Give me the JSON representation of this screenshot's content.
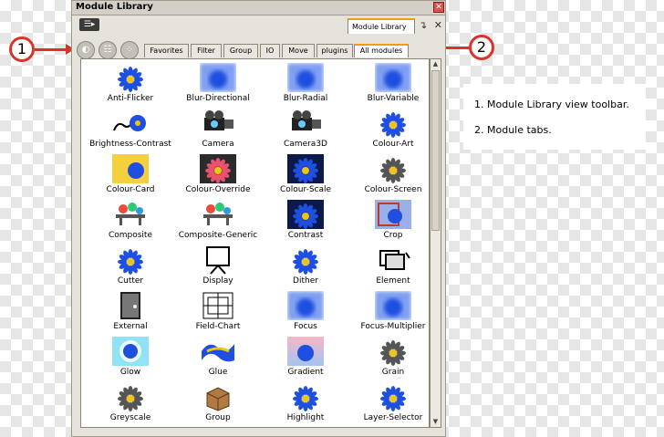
{
  "window": {
    "title": "Module Library",
    "close_glyph": "✕",
    "view_tab_label": "Module Library",
    "view_controls": "↴ ✕",
    "menu_glyph": "☰▸"
  },
  "toolbar": {
    "buttons": [
      {
        "icon": "single-view-icon",
        "glyph": "◐"
      },
      {
        "icon": "list-view-icon",
        "glyph": "☷"
      },
      {
        "icon": "thumbnail-view-icon",
        "glyph": "⁘"
      }
    ]
  },
  "tabs": [
    {
      "label": "Favorites",
      "active": false
    },
    {
      "label": "Filter",
      "active": false
    },
    {
      "label": "Group",
      "active": false
    },
    {
      "label": "IO",
      "active": false
    },
    {
      "label": "Move",
      "active": false
    },
    {
      "label": "plugins",
      "active": false
    },
    {
      "label": "All modules",
      "active": true
    }
  ],
  "modules": [
    {
      "label": "Anti-Flicker",
      "icon": "flower-icon"
    },
    {
      "label": "Blur-Directional",
      "icon": "blur-icon"
    },
    {
      "label": "Blur-Radial",
      "icon": "blur-icon"
    },
    {
      "label": "Blur-Variable",
      "icon": "blur-icon"
    },
    {
      "label": "Brightness-Contrast",
      "icon": "brightness-icon"
    },
    {
      "label": "Camera",
      "icon": "camera-icon"
    },
    {
      "label": "Camera3D",
      "icon": "camera-icon"
    },
    {
      "label": "Colour-Art",
      "icon": "flower-icon"
    },
    {
      "label": "Colour-Card",
      "icon": "colour-card-icon"
    },
    {
      "label": "Colour-Override",
      "icon": "flower-pink-icon"
    },
    {
      "label": "Colour-Scale",
      "icon": "flower-dark-icon"
    },
    {
      "label": "Colour-Screen",
      "icon": "flower-grey-icon"
    },
    {
      "label": "Composite",
      "icon": "composite-icon"
    },
    {
      "label": "Composite-Generic",
      "icon": "composite-icon"
    },
    {
      "label": "Contrast",
      "icon": "flower-dark-icon"
    },
    {
      "label": "Crop",
      "icon": "crop-icon"
    },
    {
      "label": "Cutter",
      "icon": "flower-icon"
    },
    {
      "label": "Display",
      "icon": "display-icon"
    },
    {
      "label": "Dither",
      "icon": "flower-icon"
    },
    {
      "label": "Element",
      "icon": "element-icon"
    },
    {
      "label": "External",
      "icon": "external-icon"
    },
    {
      "label": "Field-Chart",
      "icon": "field-chart-icon"
    },
    {
      "label": "Focus",
      "icon": "blur-icon"
    },
    {
      "label": "Focus-Multiplier",
      "icon": "blur-icon"
    },
    {
      "label": "Glow",
      "icon": "glow-icon"
    },
    {
      "label": "Glue",
      "icon": "glue-icon"
    },
    {
      "label": "Gradient",
      "icon": "gradient-icon"
    },
    {
      "label": "Grain",
      "icon": "flower-grey-icon"
    },
    {
      "label": "Greyscale",
      "icon": "flower-grey-icon"
    },
    {
      "label": "Group",
      "icon": "group-box-icon"
    },
    {
      "label": "Highlight",
      "icon": "flower-icon"
    },
    {
      "label": "Layer-Selector",
      "icon": "flower-icon"
    }
  ],
  "callouts": [
    {
      "number": "1"
    },
    {
      "number": "2"
    }
  ],
  "legend": [
    "1. Module Library view toolbar.",
    "2. Module tabs."
  ],
  "colors": {
    "accent_orange": "#f39c12",
    "callout_red": "#d9342b",
    "flower_blue": "#1f4fe0"
  }
}
